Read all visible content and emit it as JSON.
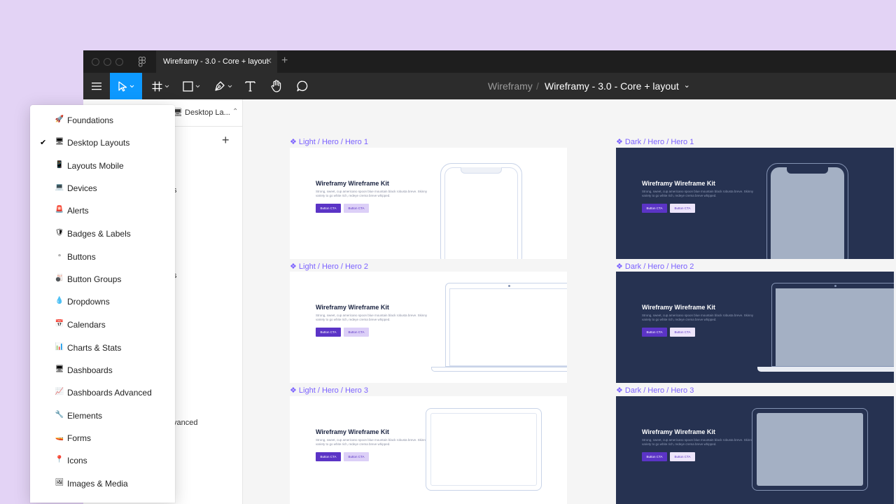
{
  "titlebar": {
    "tab_title": "Wireframy - 3.0 - Core + layout",
    "tab_close": "✕",
    "tab_add": "+"
  },
  "toolbar": {
    "breadcrumb_project": "Wireframy",
    "breadcrumb_separator": "/",
    "breadcrumb_file": "Wireframy - 3.0 - Core + layout",
    "breadcrumb_chevron": "⌄",
    "accent_color": "#0d99ff"
  },
  "panel": {
    "current_page": "🖥 Desktop La...",
    "page_chevron": "⌃",
    "add_label": "+",
    "fragments": [
      "s",
      "s",
      "vanced"
    ]
  },
  "frames": [
    {
      "label": "❖ Light / Hero / Hero 1",
      "title": "Wireframy Wireframe Kit",
      "desc": "Strong, sweet, cup americano spoon blue mountain black robusta breve. Skinny variety to go white rich, redeye crema breve whipped.",
      "btn1": "Button CTA",
      "btn2": "Button CTA"
    },
    {
      "label": "❖ Dark / Hero / Hero 1",
      "title": "Wireframy Wireframe Kit",
      "desc": "Strong, sweet, cup americano spoon blue mountain black robusta breve. Skinny variety to go white rich, redeye crema breve whipped.",
      "btn1": "Button CTA",
      "btn2": "Button CTA"
    },
    {
      "label": "❖ Light / Hero / Hero 2",
      "title": "Wireframy Wireframe Kit",
      "desc": "Strong, sweet, cup americano spoon blue mountain black robusta breve. Skinny variety to go white rich, redeye crema breve whipped.",
      "btn1": "Button CTA",
      "btn2": "Button CTA"
    },
    {
      "label": "❖ Dark / Hero / Hero 2",
      "title": "Wireframy Wireframe Kit",
      "desc": "Strong, sweet, cup americano spoon blue mountain black robusta breve. Skinny variety to go white rich, redeye crema breve whipped.",
      "btn1": "Button CTA",
      "btn2": "Button CTA"
    },
    {
      "label": "❖ Light / Hero / Hero 3",
      "title": "Wireframy Wireframe Kit",
      "desc": "Strong, sweet, cup americano spoon blue mountain black robusta breve. Skinny variety to go white rich, redeye crema breve whipped.",
      "btn1": "Button CTA",
      "btn2": "Button CTA"
    },
    {
      "label": "❖ Dark / Hero / Hero 3",
      "title": "Wireframy Wireframe Kit",
      "desc": "Strong, sweet, cup americano spoon blue mountain black robusta breve. Skinny variety to go white rich, redeye crema breve whipped.",
      "btn1": "Button CTA",
      "btn2": "Button CTA"
    }
  ],
  "dropdown": {
    "items": [
      {
        "emoji": "🚀",
        "label": "Foundations",
        "check": ""
      },
      {
        "emoji": "🖥",
        "label": "Desktop Layouts",
        "check": "✔"
      },
      {
        "emoji": "📱",
        "label": "Layouts Mobile",
        "check": ""
      },
      {
        "emoji": "💻",
        "label": "Devices",
        "check": ""
      },
      {
        "emoji": "🚨",
        "label": "Alerts",
        "check": ""
      },
      {
        "emoji": "🛡",
        "label": "Badges & Labels",
        "check": ""
      },
      {
        "emoji": "▫",
        "label": "Buttons",
        "check": ""
      },
      {
        "emoji": "🎳",
        "label": "Button Groups",
        "check": ""
      },
      {
        "emoji": "💧",
        "label": "Dropdowns",
        "check": ""
      },
      {
        "emoji": "📅",
        "label": "Calendars",
        "check": ""
      },
      {
        "emoji": "📊",
        "label": "Charts & Stats",
        "check": ""
      },
      {
        "emoji": "🖥",
        "label": "Dashboards",
        "check": ""
      },
      {
        "emoji": "📈",
        "label": "Dashboards Advanced",
        "check": ""
      },
      {
        "emoji": "🔧",
        "label": "Elements",
        "check": ""
      },
      {
        "emoji": "🚤",
        "label": "Forms",
        "check": ""
      },
      {
        "emoji": "📍",
        "label": "Icons",
        "check": ""
      },
      {
        "emoji": "🖼",
        "label": "Images & Media",
        "check": ""
      }
    ]
  }
}
